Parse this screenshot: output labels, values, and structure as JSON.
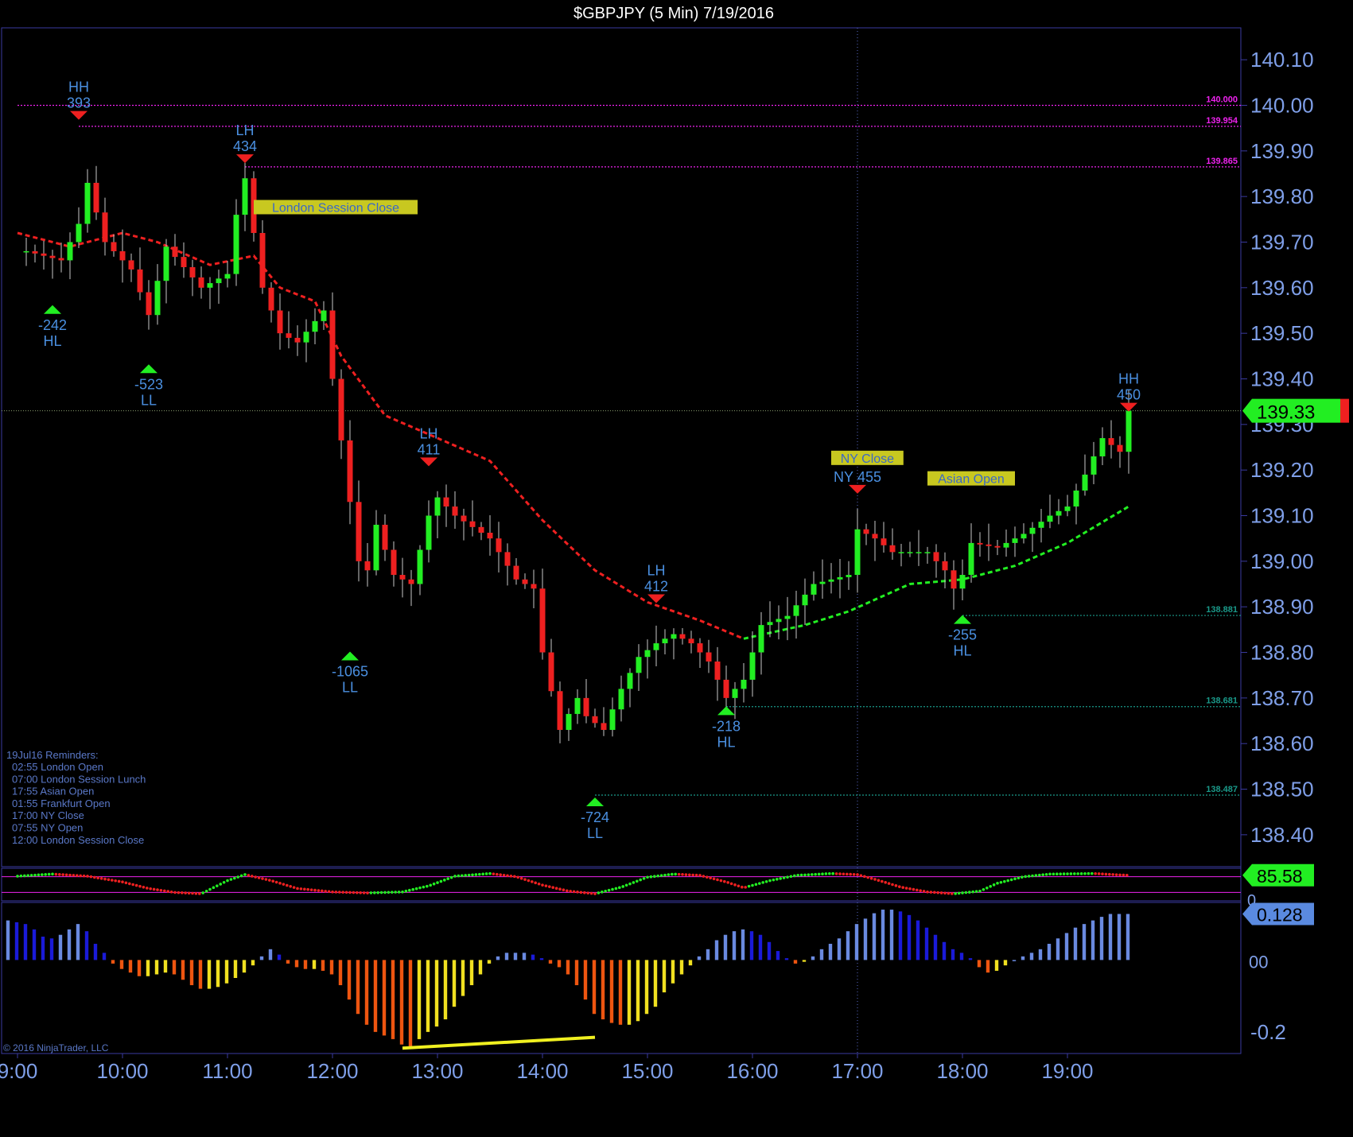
{
  "title": "$GBPJPY (5 Min)  7/19/2016",
  "copyright": "© 2016 NinjaTrader, LLC",
  "colors": {
    "background": "#000000",
    "frame": "#3a3aa0",
    "up": "#22ee22",
    "down": "#ee2020",
    "axis_text": "#7f9fe8",
    "swing_text": "#4a8fe0",
    "resistance": "#ee22ee",
    "support": "#1a9a8a",
    "ema_down": "#ee2020",
    "ema_up": "#22ee22"
  },
  "chart_data": [
    {
      "type": "candlestick",
      "name": "price",
      "ylim": [
        138.33,
        140.17
      ],
      "yticks": [
        "140.10",
        "140.00",
        "139.90",
        "139.80",
        "139.70",
        "139.60",
        "139.50",
        "139.40",
        "139.30",
        "139.20",
        "139.10",
        "139.00",
        "138.90",
        "138.80",
        "138.70",
        "138.60",
        "138.50",
        "138.40"
      ],
      "xticks": [
        "9:00",
        "10:00",
        "11:00",
        "12:00",
        "13:00",
        "14:00",
        "15:00",
        "16:00",
        "17:00",
        "18:00",
        "19:00"
      ],
      "x_start": "9:00",
      "bar_minutes": 5,
      "last_price": "139.33",
      "anchors": [
        {
          "t": "9:05",
          "p": 139.68
        },
        {
          "t": "9:25",
          "p": 139.66
        },
        {
          "t": "9:35",
          "p": 139.74
        },
        {
          "t": "9:40",
          "p": 139.83
        },
        {
          "t": "9:50",
          "p": 139.7
        },
        {
          "t": "10:05",
          "p": 139.64
        },
        {
          "t": "10:15",
          "p": 139.54
        },
        {
          "t": "10:25",
          "p": 139.69
        },
        {
          "t": "10:45",
          "p": 139.6
        },
        {
          "t": "11:00",
          "p": 139.63
        },
        {
          "t": "11:05",
          "p": 139.76
        },
        {
          "t": "11:10",
          "p": 139.84
        },
        {
          "t": "11:20",
          "p": 139.6
        },
        {
          "t": "11:30",
          "p": 139.5
        },
        {
          "t": "11:40",
          "p": 139.48
        },
        {
          "t": "11:55",
          "p": 139.55
        },
        {
          "t": "12:00",
          "p": 139.4
        },
        {
          "t": "12:10",
          "p": 139.13
        },
        {
          "t": "12:15",
          "p": 139.0
        },
        {
          "t": "12:20",
          "p": 138.98
        },
        {
          "t": "12:25",
          "p": 139.08
        },
        {
          "t": "12:35",
          "p": 138.97
        },
        {
          "t": "12:45",
          "p": 138.95
        },
        {
          "t": "12:55",
          "p": 139.1
        },
        {
          "t": "13:00",
          "p": 139.14
        },
        {
          "t": "13:10",
          "p": 139.1
        },
        {
          "t": "13:30",
          "p": 139.05
        },
        {
          "t": "13:45",
          "p": 138.96
        },
        {
          "t": "13:55",
          "p": 138.94
        },
        {
          "t": "14:00",
          "p": 138.8
        },
        {
          "t": "14:10",
          "p": 138.63
        },
        {
          "t": "14:20",
          "p": 138.7
        },
        {
          "t": "14:25",
          "p": 138.66
        },
        {
          "t": "14:35",
          "p": 138.63
        },
        {
          "t": "14:45",
          "p": 138.72
        },
        {
          "t": "14:55",
          "p": 138.79
        },
        {
          "t": "15:05",
          "p": 138.82
        },
        {
          "t": "15:15",
          "p": 138.84
        },
        {
          "t": "15:25",
          "p": 138.82
        },
        {
          "t": "15:35",
          "p": 138.78
        },
        {
          "t": "15:45",
          "p": 138.7
        },
        {
          "t": "15:55",
          "p": 138.74
        },
        {
          "t": "16:05",
          "p": 138.86
        },
        {
          "t": "16:20",
          "p": 138.88
        },
        {
          "t": "16:35",
          "p": 138.95
        },
        {
          "t": "16:55",
          "p": 138.97
        },
        {
          "t": "17:00",
          "p": 139.07
        },
        {
          "t": "17:10",
          "p": 139.05
        },
        {
          "t": "17:20",
          "p": 139.02
        },
        {
          "t": "17:40",
          "p": 139.02
        },
        {
          "t": "17:50",
          "p": 138.98
        },
        {
          "t": "17:55",
          "p": 138.94
        },
        {
          "t": "18:00",
          "p": 138.97
        },
        {
          "t": "18:05",
          "p": 139.04
        },
        {
          "t": "18:20",
          "p": 139.03
        },
        {
          "t": "18:35",
          "p": 139.06
        },
        {
          "t": "18:50",
          "p": 139.1
        },
        {
          "t": "19:00",
          "p": 139.12
        },
        {
          "t": "19:10",
          "p": 139.19
        },
        {
          "t": "19:20",
          "p": 139.27
        },
        {
          "t": "19:30",
          "p": 139.24
        },
        {
          "t": "19:35",
          "p": 139.33
        }
      ],
      "ema_down": [
        {
          "t": "9:00",
          "p": 139.72
        },
        {
          "t": "9:30",
          "p": 139.69
        },
        {
          "t": "10:00",
          "p": 139.72
        },
        {
          "t": "10:20",
          "p": 139.7
        },
        {
          "t": "10:50",
          "p": 139.65
        },
        {
          "t": "11:15",
          "p": 139.67
        },
        {
          "t": "11:30",
          "p": 139.6
        },
        {
          "t": "11:50",
          "p": 139.57
        },
        {
          "t": "12:05",
          "p": 139.45
        },
        {
          "t": "12:30",
          "p": 139.32
        },
        {
          "t": "13:00",
          "p": 139.27
        },
        {
          "t": "13:30",
          "p": 139.22
        },
        {
          "t": "14:00",
          "p": 139.09
        },
        {
          "t": "14:30",
          "p": 138.98
        },
        {
          "t": "15:00",
          "p": 138.91
        },
        {
          "t": "15:30",
          "p": 138.87
        },
        {
          "t": "15:55",
          "p": 138.83
        }
      ],
      "ema_up": [
        {
          "t": "15:55",
          "p": 138.83
        },
        {
          "t": "16:30",
          "p": 138.86
        },
        {
          "t": "16:55",
          "p": 138.89
        },
        {
          "t": "17:30",
          "p": 138.95
        },
        {
          "t": "18:00",
          "p": 138.96
        },
        {
          "t": "18:30",
          "p": 138.99
        },
        {
          "t": "19:00",
          "p": 139.04
        },
        {
          "t": "19:35",
          "p": 139.12
        }
      ],
      "levels": [
        {
          "label": "140.000",
          "value": 140.0,
          "kind": "resistance",
          "x0": "9:00"
        },
        {
          "label": "139.954",
          "value": 139.954,
          "kind": "resistance",
          "x0": "9:35"
        },
        {
          "label": "139.865",
          "value": 139.865,
          "kind": "resistance",
          "x0": "11:10"
        },
        {
          "label": "138.881",
          "value": 138.881,
          "kind": "support",
          "x0": "18:00"
        },
        {
          "label": "138.681",
          "value": 138.681,
          "kind": "support",
          "x0": "15:45"
        },
        {
          "label": "138.487",
          "value": 138.487,
          "kind": "support",
          "x0": "14:30"
        }
      ],
      "swing_points": [
        {
          "t": "9:35",
          "p": 139.97,
          "kind": "high",
          "lines": [
            "HH",
            "393"
          ]
        },
        {
          "t": "11:10",
          "p": 139.875,
          "kind": "high",
          "lines": [
            "LH",
            "434"
          ]
        },
        {
          "t": "12:55",
          "p": 139.21,
          "kind": "high",
          "lines": [
            "LH",
            "411"
          ]
        },
        {
          "t": "15:05",
          "p": 138.91,
          "kind": "high",
          "lines": [
            "LH",
            "412"
          ]
        },
        {
          "t": "17:00",
          "p": 139.15,
          "kind": "high",
          "lines": [
            "NY 455"
          ]
        },
        {
          "t": "19:35",
          "p": 139.33,
          "kind": "high",
          "lines": [
            "HH",
            "450"
          ]
        },
        {
          "t": "9:20",
          "p": 139.56,
          "kind": "low",
          "lines": [
            "-242",
            "HL"
          ]
        },
        {
          "t": "10:15",
          "p": 139.43,
          "kind": "low",
          "lines": [
            "-523",
            "LL"
          ]
        },
        {
          "t": "12:10",
          "p": 138.8,
          "kind": "low",
          "lines": [
            "-1065",
            "LL"
          ]
        },
        {
          "t": "14:30",
          "p": 138.48,
          "kind": "low",
          "lines": [
            "-724",
            "LL"
          ]
        },
        {
          "t": "15:45",
          "p": 138.68,
          "kind": "low",
          "lines": [
            "-218",
            "HL"
          ]
        },
        {
          "t": "18:00",
          "p": 138.88,
          "kind": "low",
          "lines": [
            "-255",
            "HL"
          ]
        }
      ],
      "session_boxes": [
        {
          "label": "London Session Close",
          "t": "11:15",
          "p": 139.775
        },
        {
          "label": "NY Close",
          "t": "16:45",
          "p": 139.225
        },
        {
          "label": "Asian Open",
          "t": "17:40",
          "p": 139.18
        }
      ],
      "vertical_marker": "17:00",
      "reminders": {
        "heading": "19Jul16 Reminders:",
        "items": [
          "02:55 London Open",
          "07:00 London Session Lunch",
          "17:55 Asian Open",
          "01:55 Frankfurt Open",
          "17:00 NY Close",
          "07:55 NY Open",
          "12:00 London Session Close"
        ]
      }
    },
    {
      "type": "line",
      "name": "stochastic",
      "ylim": [
        0,
        100
      ],
      "last_value": "85.58",
      "zero_label": "0",
      "points": [
        {
          "t": "9:00",
          "v": 82
        },
        {
          "t": "9:20",
          "v": 90
        },
        {
          "t": "9:40",
          "v": 82
        },
        {
          "t": "10:00",
          "v": 60
        },
        {
          "t": "10:15",
          "v": 35
        },
        {
          "t": "10:30",
          "v": 20
        },
        {
          "t": "10:45",
          "v": 15
        },
        {
          "t": "11:00",
          "v": 65
        },
        {
          "t": "11:10",
          "v": 88
        },
        {
          "t": "11:25",
          "v": 65
        },
        {
          "t": "11:40",
          "v": 35
        },
        {
          "t": "12:00",
          "v": 22
        },
        {
          "t": "12:20",
          "v": 18
        },
        {
          "t": "12:40",
          "v": 22
        },
        {
          "t": "12:55",
          "v": 45
        },
        {
          "t": "13:10",
          "v": 82
        },
        {
          "t": "13:30",
          "v": 92
        },
        {
          "t": "13:45",
          "v": 80
        },
        {
          "t": "14:00",
          "v": 48
        },
        {
          "t": "14:15",
          "v": 25
        },
        {
          "t": "14:30",
          "v": 15
        },
        {
          "t": "14:45",
          "v": 40
        },
        {
          "t": "15:00",
          "v": 78
        },
        {
          "t": "15:15",
          "v": 90
        },
        {
          "t": "15:30",
          "v": 85
        },
        {
          "t": "15:45",
          "v": 60
        },
        {
          "t": "15:55",
          "v": 38
        },
        {
          "t": "16:10",
          "v": 65
        },
        {
          "t": "16:25",
          "v": 85
        },
        {
          "t": "16:45",
          "v": 92
        },
        {
          "t": "17:00",
          "v": 88
        },
        {
          "t": "17:10",
          "v": 70
        },
        {
          "t": "17:25",
          "v": 40
        },
        {
          "t": "17:40",
          "v": 22
        },
        {
          "t": "17:55",
          "v": 15
        },
        {
          "t": "18:10",
          "v": 25
        },
        {
          "t": "18:20",
          "v": 55
        },
        {
          "t": "18:35",
          "v": 80
        },
        {
          "t": "18:50",
          "v": 90
        },
        {
          "t": "19:15",
          "v": 92
        },
        {
          "t": "19:35",
          "v": 85
        }
      ]
    },
    {
      "type": "bar",
      "name": "momentum histogram",
      "ylim": [
        -0.26,
        0.16
      ],
      "yticks": [
        "-0.2"
      ],
      "zero_label": "00",
      "last_value": "0.128",
      "divergence_line": {
        "t0": "12:40",
        "v0": -0.245,
        "t1": "14:30",
        "v1": -0.215
      },
      "values": [
        0.11,
        0.105,
        0.1,
        0.085,
        0.065,
        0.06,
        0.07,
        0.085,
        0.1,
        0.08,
        0.045,
        0.02,
        -0.01,
        -0.025,
        -0.035,
        -0.045,
        -0.045,
        -0.04,
        -0.035,
        -0.04,
        -0.055,
        -0.07,
        -0.08,
        -0.08,
        -0.075,
        -0.065,
        -0.05,
        -0.035,
        -0.015,
        0.01,
        0.03,
        0.015,
        -0.01,
        -0.02,
        -0.025,
        -0.025,
        -0.03,
        -0.04,
        -0.07,
        -0.11,
        -0.15,
        -0.18,
        -0.2,
        -0.21,
        -0.22,
        -0.235,
        -0.24,
        -0.22,
        -0.2,
        -0.185,
        -0.165,
        -0.13,
        -0.1,
        -0.07,
        -0.04,
        -0.01,
        0.01,
        0.02,
        0.02,
        0.02,
        0.015,
        0.005,
        -0.01,
        -0.02,
        -0.04,
        -0.07,
        -0.11,
        -0.15,
        -0.165,
        -0.175,
        -0.18,
        -0.18,
        -0.17,
        -0.15,
        -0.13,
        -0.09,
        -0.065,
        -0.04,
        -0.015,
        0.01,
        0.03,
        0.055,
        0.07,
        0.08,
        0.085,
        0.08,
        0.07,
        0.05,
        0.025,
        0.005,
        -0.01,
        -0.005,
        0.01,
        0.03,
        0.045,
        0.06,
        0.08,
        0.1,
        0.115,
        0.13,
        0.14,
        0.14,
        0.135,
        0.125,
        0.11,
        0.09,
        0.07,
        0.05,
        0.03,
        0.02,
        0.005,
        -0.02,
        -0.035,
        -0.03,
        -0.015,
        0.0,
        0.01,
        0.02,
        0.03,
        0.045,
        0.06,
        0.075,
        0.09,
        0.1,
        0.11,
        0.12,
        0.128,
        0.128,
        0.128
      ]
    }
  ]
}
